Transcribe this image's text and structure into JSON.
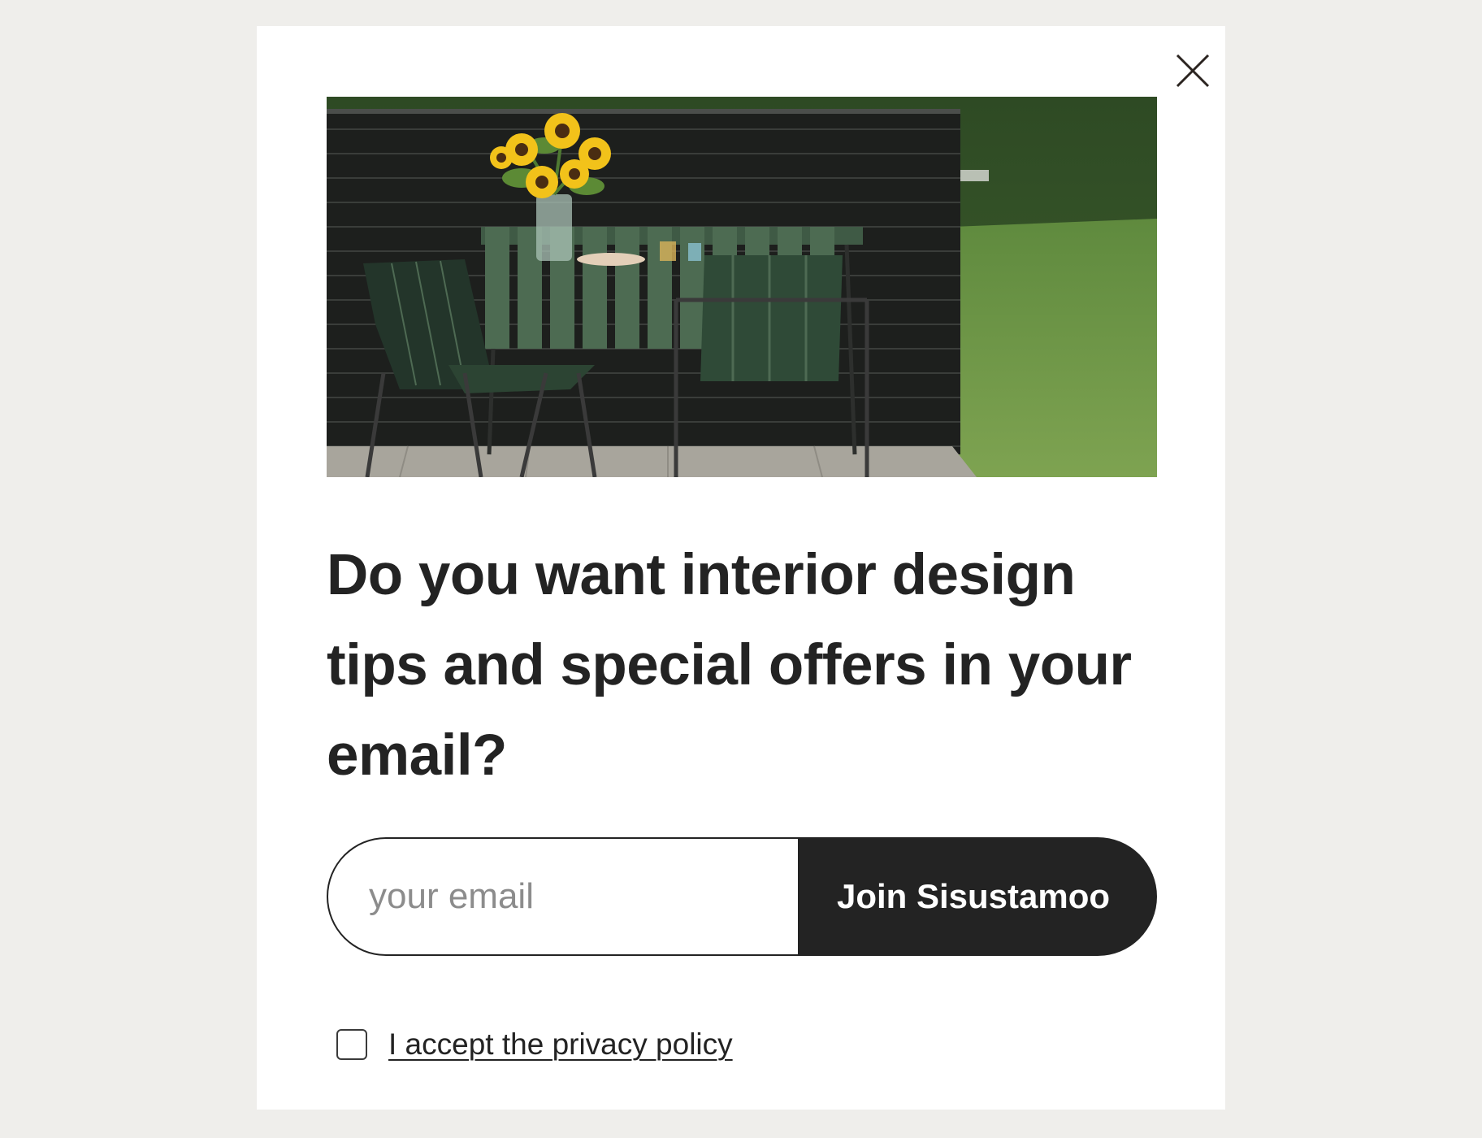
{
  "modal": {
    "close_icon": "close-icon",
    "hero_image_alt": "",
    "headline": "Do you want interior design tips and special offers in your email?",
    "email_placeholder": "your email",
    "submit_label": "Join Sisustamoo",
    "consent_label": "I accept the privacy policy",
    "consent_checked": false
  },
  "colors": {
    "page_background": "#efeeeb",
    "modal_background": "#ffffff",
    "primary_dark": "#232323",
    "placeholder_gray": "#8c8c8c"
  }
}
